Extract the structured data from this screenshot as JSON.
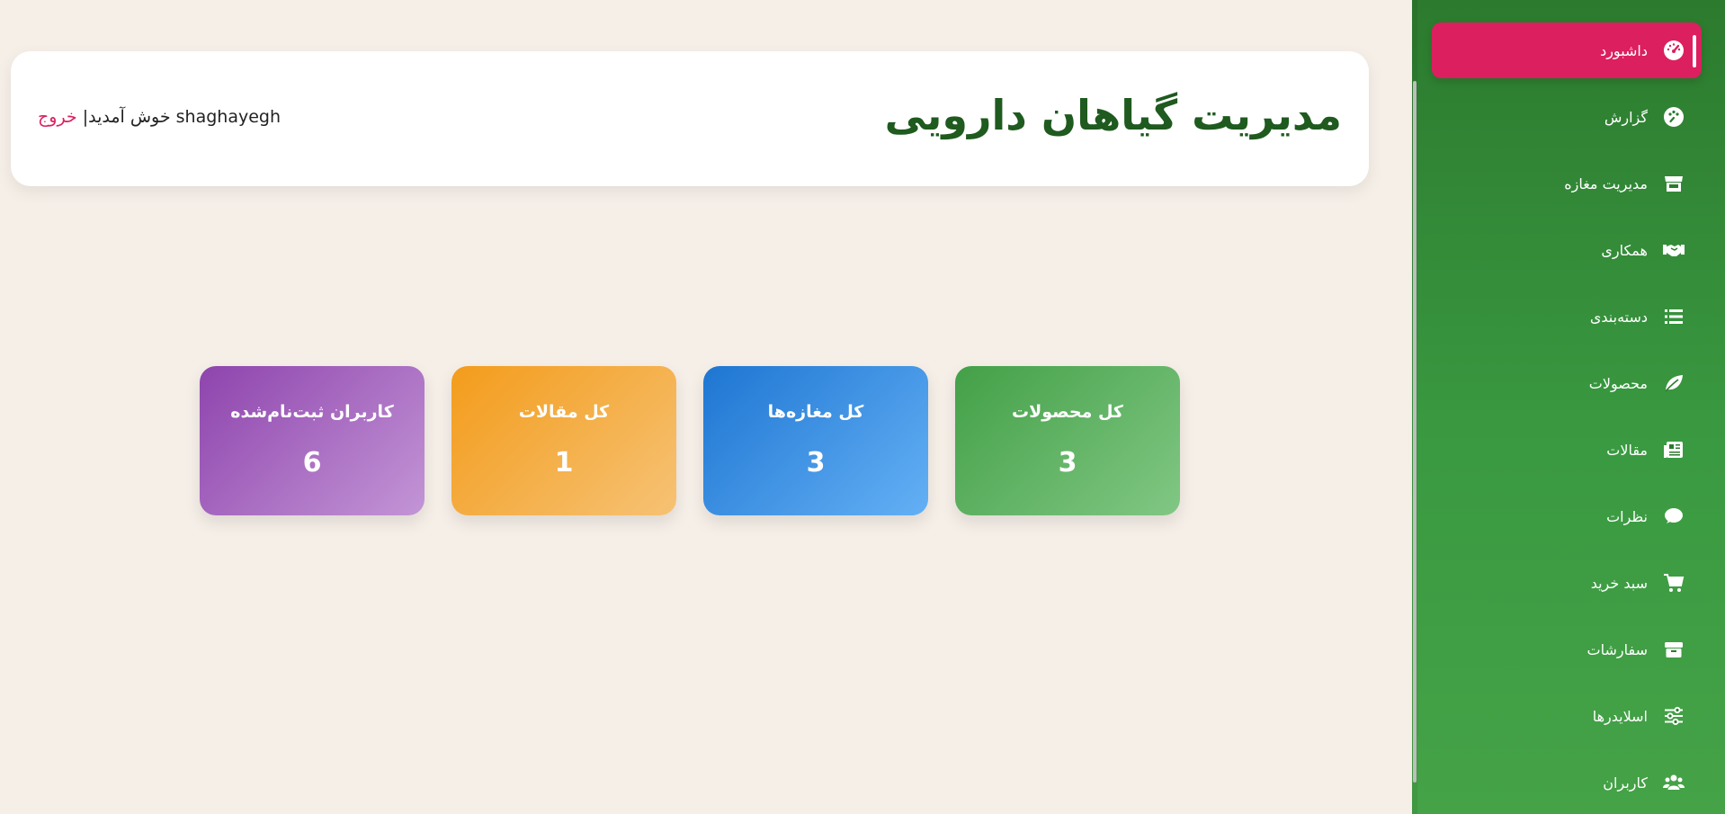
{
  "header": {
    "title": "مدیریت گیاهان دارویی",
    "username": "shaghayegh",
    "welcome_text": "خوش آمدید|",
    "logout_label": "خروج"
  },
  "sidebar": {
    "items": [
      {
        "label": "داشبورد",
        "icon": "dashboard-gauge-icon",
        "active": true
      },
      {
        "label": "گزارش",
        "icon": "palette-icon"
      },
      {
        "label": "مدیریت مغازه",
        "icon": "store-icon"
      },
      {
        "label": "همکاری",
        "icon": "handshake-icon"
      },
      {
        "label": "دسته‌بندی",
        "icon": "list-icon"
      },
      {
        "label": "محصولات",
        "icon": "leaf-icon"
      },
      {
        "label": "مقالات",
        "icon": "newspaper-icon"
      },
      {
        "label": "نظرات",
        "icon": "comment-icon"
      },
      {
        "label": "سبد خرید",
        "icon": "cart-icon"
      },
      {
        "label": "سفارشات",
        "icon": "box-icon"
      },
      {
        "label": "اسلایدرها",
        "icon": "sliders-icon"
      },
      {
        "label": "کاربران",
        "icon": "users-icon"
      }
    ]
  },
  "stats": [
    {
      "label": "کل محصولات",
      "value": "3",
      "color": "#43a047"
    },
    {
      "label": "کل مغازه‌ها",
      "value": "3",
      "color": "#1e76d2"
    },
    {
      "label": "کل مقالات",
      "value": "1",
      "color": "#f39c1b"
    },
    {
      "label": "کاربران ثبت‌نام‌شده",
      "value": "6",
      "color": "#8e44ad"
    }
  ],
  "colors": {
    "sidebar_green": "#2c7a2e",
    "active_pink": "#dc1f5f",
    "title_green": "#1f5a1f",
    "background": "#f6efe8"
  }
}
